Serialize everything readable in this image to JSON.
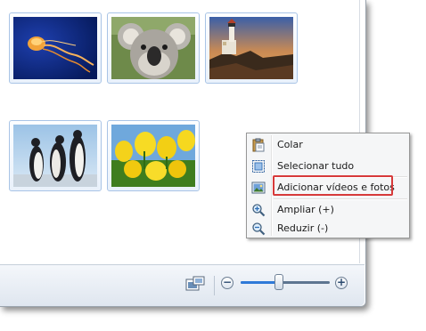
{
  "thumbnails": [
    {
      "name": "jellyfish",
      "icon": "photo-jellyfish"
    },
    {
      "name": "koala",
      "icon": "photo-koala"
    },
    {
      "name": "lighthouse",
      "icon": "photo-lighthouse"
    },
    {
      "name": "penguins",
      "icon": "photo-penguins"
    },
    {
      "name": "tulips",
      "icon": "photo-tulips"
    }
  ],
  "context_menu": {
    "items": [
      {
        "label": "Colar",
        "icon": "paste-icon",
        "enabled": true
      },
      {
        "label": "Selecionar tudo",
        "icon": "select-all-icon",
        "enabled": true
      },
      {
        "label": "Adicionar vídeos e fotos",
        "icon": "add-photos-icon",
        "enabled": true,
        "highlighted": true
      },
      {
        "label": "Ampliar (+)",
        "icon": "zoom-in-icon",
        "enabled": true
      },
      {
        "label": "Reduzir (-)",
        "icon": "zoom-out-icon",
        "enabled": true
      }
    ]
  },
  "toolbar": {
    "thumbnail_view_icon": "thumbnail-view-icon",
    "zoom_out_symbol": "−",
    "zoom_in_symbol": "+",
    "zoom_level": 0.43
  },
  "colors": {
    "highlight_border": "#d73a3a",
    "thumb_border": "#a9c4e6",
    "menu_background": "#f5f6f7"
  }
}
